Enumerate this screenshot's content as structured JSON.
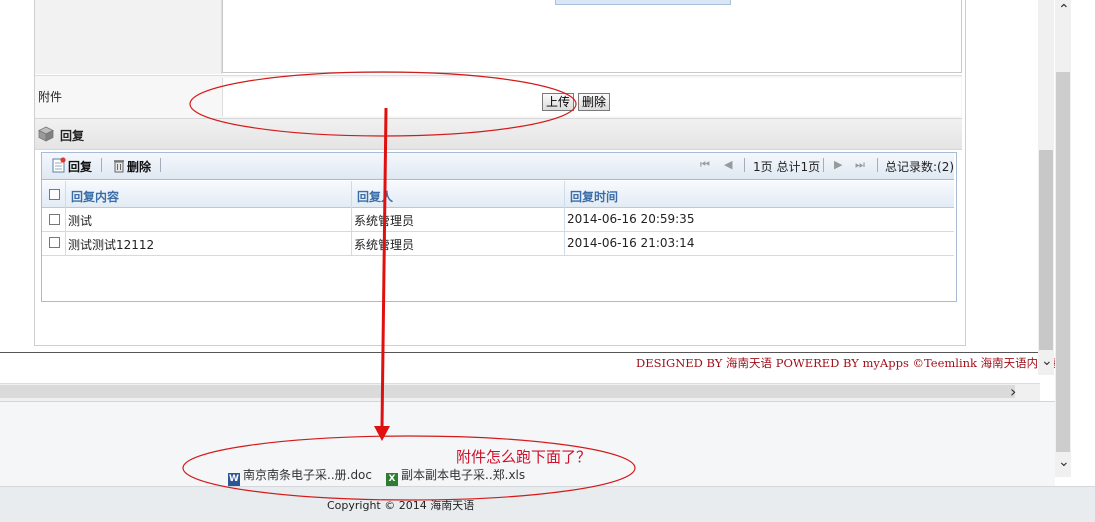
{
  "attachment": {
    "label": "附件",
    "upload_label": "上传",
    "delete_label": "删除"
  },
  "reply_section": {
    "title": "回复",
    "toolbar": {
      "reply_label": "回复",
      "delete_label": "删除",
      "page_info": "1页 总计1页",
      "total_records": "总记录数:(2)"
    },
    "columns": [
      "回复内容",
      "回复人",
      "回复时间"
    ],
    "rows": [
      {
        "content": "测试",
        "person": "系统管理员",
        "time": "2014-06-16 20:59:35"
      },
      {
        "content": "测试测试12112",
        "person": "系统管理员",
        "time": "2014-06-16 21:03:14"
      }
    ]
  },
  "footer": {
    "designed_by": "DESIGNED BY 海南天语  POWERED BY myApps ©Teemlink 海南天语内部使",
    "files": [
      {
        "name": "南京南条电子采..册.doc",
        "icon": "word-doc-icon"
      },
      {
        "name": "副本副本电子采..郑.xls",
        "icon": "excel-xls-icon"
      }
    ],
    "copyright": "Copyright © 2014 海南天语"
  },
  "annotation": {
    "text": "附件怎么跑下面了？",
    "color": "#d0102a"
  },
  "icons": {
    "chevron_up": "⌃",
    "chevron_down": "⌄",
    "chevron_right": "›",
    "first": "⏮",
    "prev": "◀",
    "next": "▶",
    "last": "⏭"
  }
}
